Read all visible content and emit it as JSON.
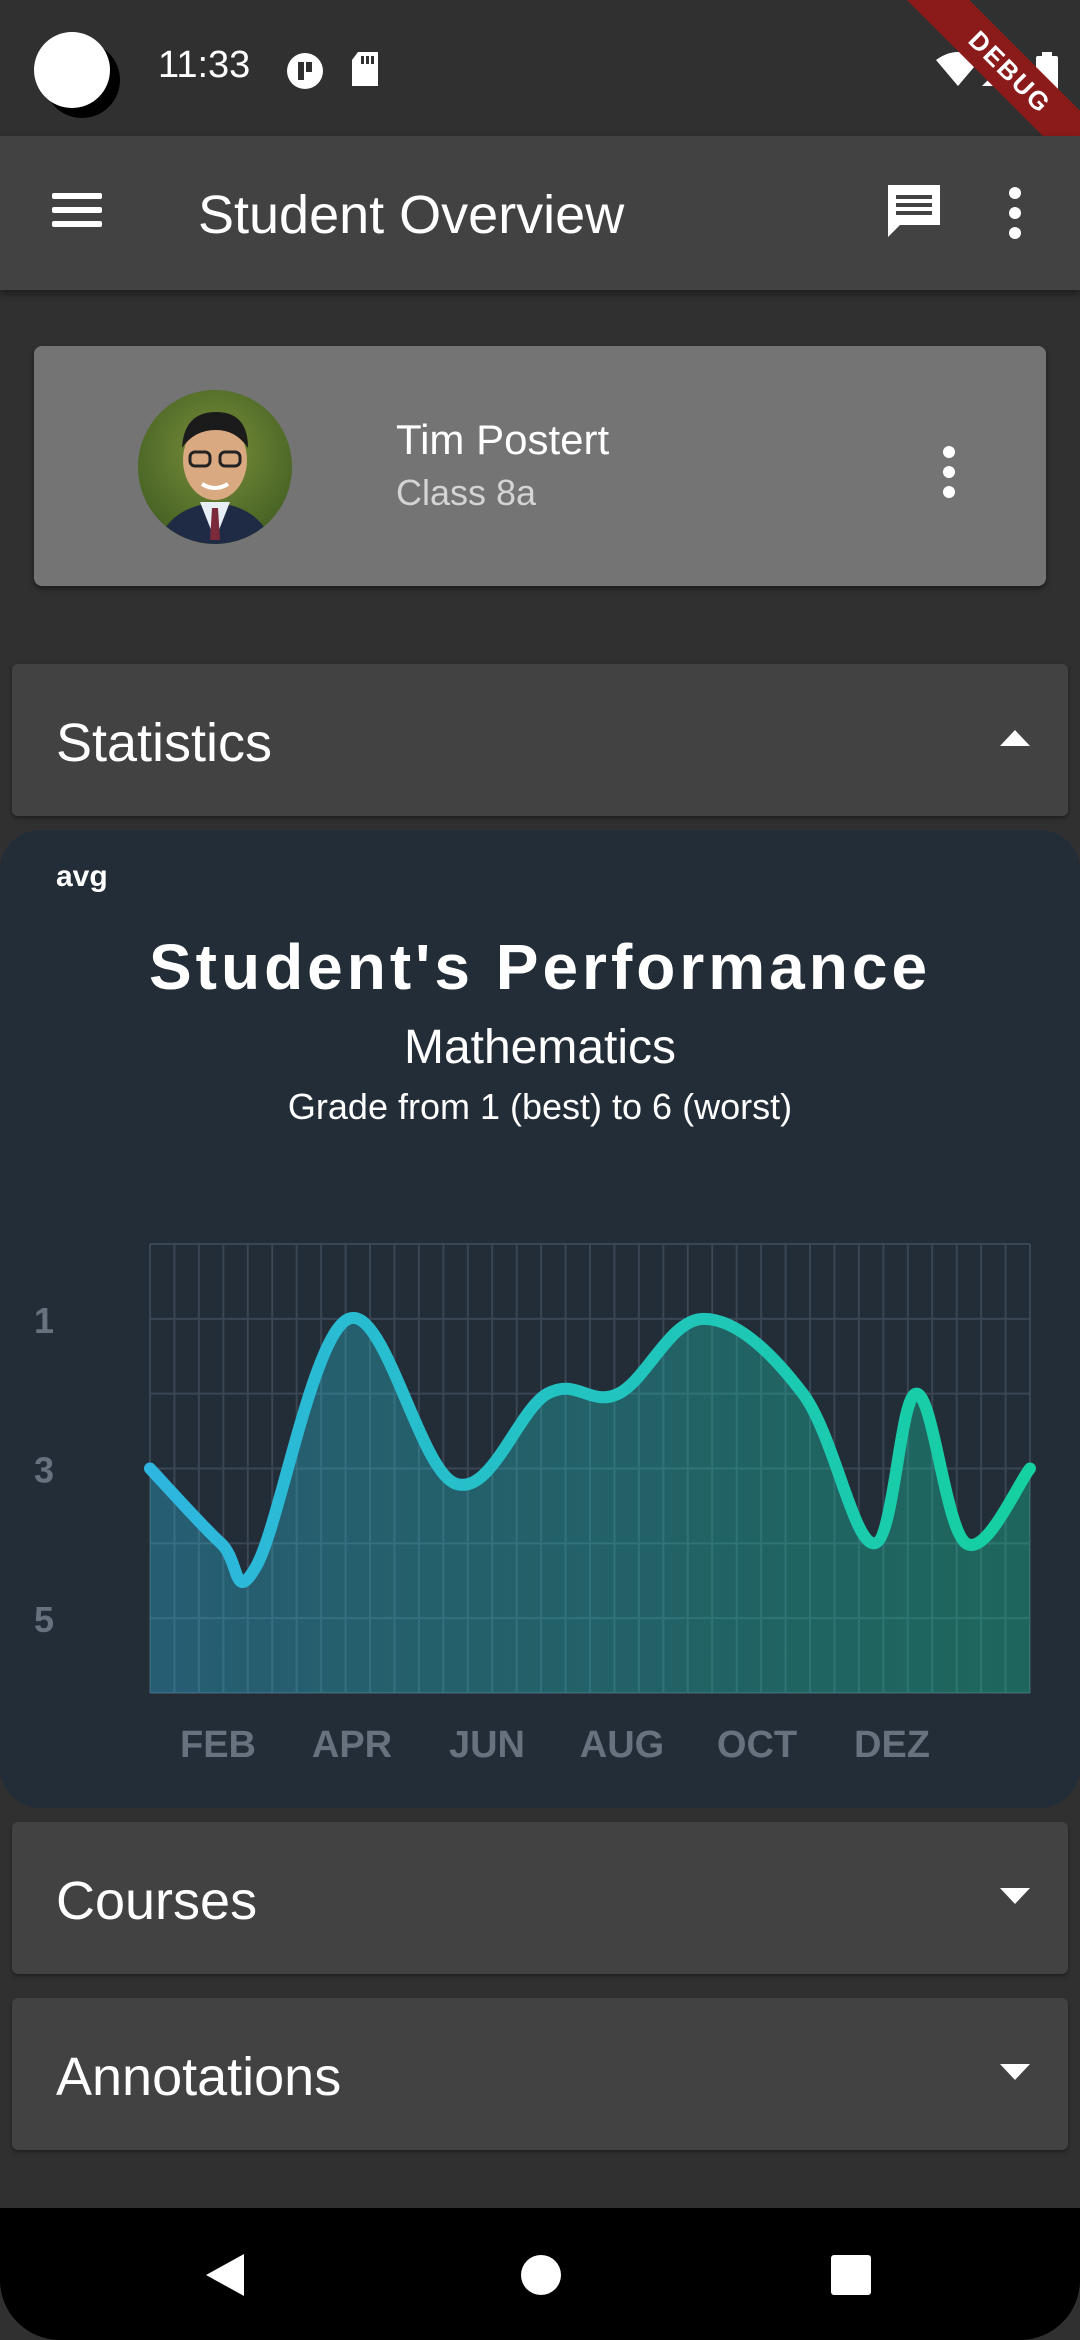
{
  "status_bar": {
    "time": "11:33",
    "debug_label": "DEBUG"
  },
  "app_bar": {
    "title": "Student Overview"
  },
  "profile": {
    "name": "Tim Postert",
    "class": "Class 8a"
  },
  "panels": {
    "statistics": "Statistics",
    "courses": "Courses",
    "annotations": "Annotations"
  },
  "chart_data": {
    "type": "area",
    "corner_label": "avg",
    "title": "Student's Performance",
    "subtitle": "Mathematics",
    "description": "Grade from 1 (best) to 6 (worst)",
    "x_labels": [
      "FEB",
      "APR",
      "JUN",
      "AUG",
      "OCT",
      "DEZ"
    ],
    "y_labels": [
      "1",
      "3",
      "5"
    ],
    "ylim": [
      6,
      0
    ],
    "y_inverted": true,
    "grid": true,
    "points": [
      {
        "x": 0,
        "y": 3.0
      },
      {
        "x": 1,
        "y": 4.0
      },
      {
        "x": 1.5,
        "y": 4.3
      },
      {
        "x": 2.8,
        "y": 1.0
      },
      {
        "x": 4.3,
        "y": 3.2
      },
      {
        "x": 5.6,
        "y": 2.0
      },
      {
        "x": 6.6,
        "y": 2.0
      },
      {
        "x": 7.8,
        "y": 1.0
      },
      {
        "x": 9.2,
        "y": 2.0
      },
      {
        "x": 10.2,
        "y": 4.0
      },
      {
        "x": 10.8,
        "y": 2.0
      },
      {
        "x": 11.5,
        "y": 4.0
      },
      {
        "x": 12.4,
        "y": 3.0
      }
    ],
    "colors": {
      "start": "#2fb6e0",
      "end": "#15d0a0"
    }
  }
}
